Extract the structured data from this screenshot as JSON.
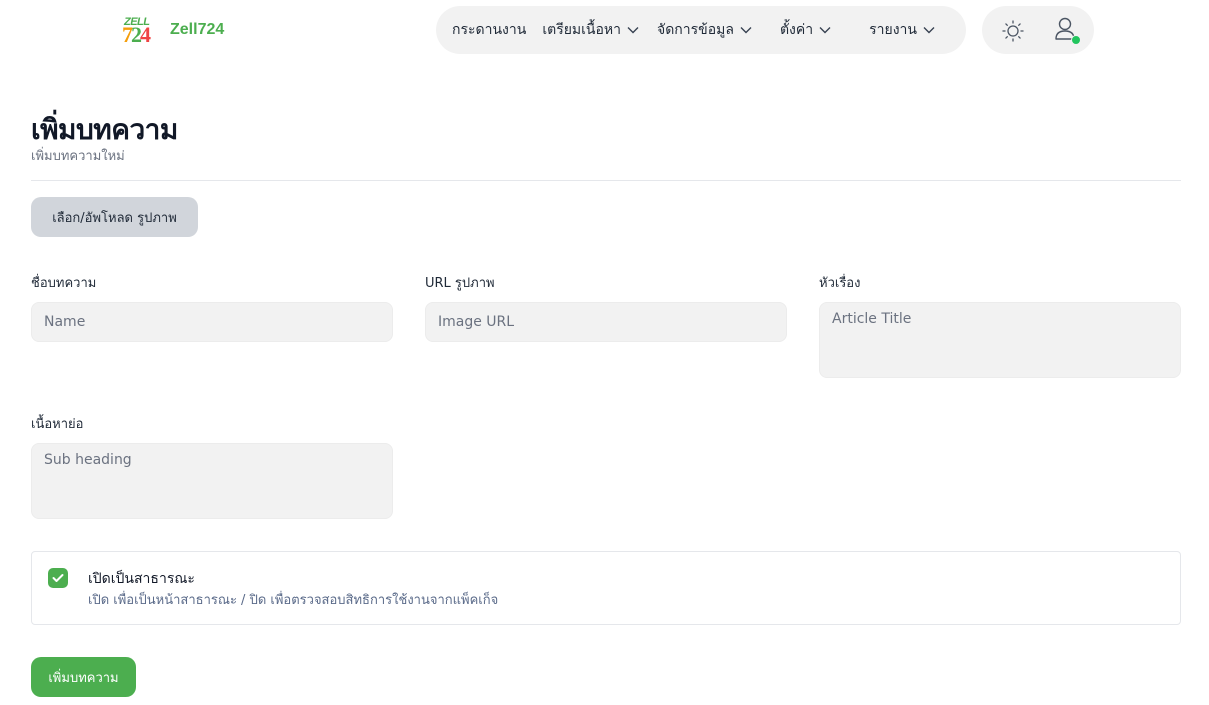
{
  "brand": {
    "logo_top": "ZELL",
    "logo_digits": [
      "7",
      "2",
      "4"
    ],
    "name": "Zell724"
  },
  "nav": {
    "items": [
      {
        "label": "กระดานงาน",
        "has_dropdown": false
      },
      {
        "label": "เตรียมเนื้อหา",
        "has_dropdown": true
      },
      {
        "label": "จัดการข้อมูล",
        "has_dropdown": true
      },
      {
        "label": "ตั้งค่า",
        "has_dropdown": true
      },
      {
        "label": "รายงาน",
        "has_dropdown": true
      }
    ]
  },
  "tools": {
    "theme_icon": "sun-icon",
    "user_icon": "user-icon",
    "status_color": "#22c55e"
  },
  "page": {
    "title": "เพิ่มบทความ",
    "subtitle": "เพิ่มบทความใหม่"
  },
  "upload": {
    "label": "เลือก/อัพโหลด รูปภาพ"
  },
  "form": {
    "name": {
      "label": "ชื่อบทความ",
      "placeholder": "Name",
      "value": ""
    },
    "image_url": {
      "label": "URL รูปภาพ",
      "placeholder": "Image URL",
      "value": ""
    },
    "title": {
      "label": "หัวเรื่อง",
      "placeholder": "Article Title",
      "value": ""
    },
    "sub_heading": {
      "label": "เนื้อหาย่อ",
      "placeholder": "Sub heading",
      "value": ""
    }
  },
  "public_toggle": {
    "checked": true,
    "title": "เปิดเป็นสาธารณะ",
    "description": "เปิด เพื่อเป็นหน้าสาธารณะ / ปิด เพื่อตรวจสอบสิทธิการใช้งานจากแพ็คเก็จ"
  },
  "submit": {
    "label": "เพิ่มบทความ"
  },
  "colors": {
    "brand_green": "#4cae4f",
    "field_bg": "#f2f2f2"
  }
}
